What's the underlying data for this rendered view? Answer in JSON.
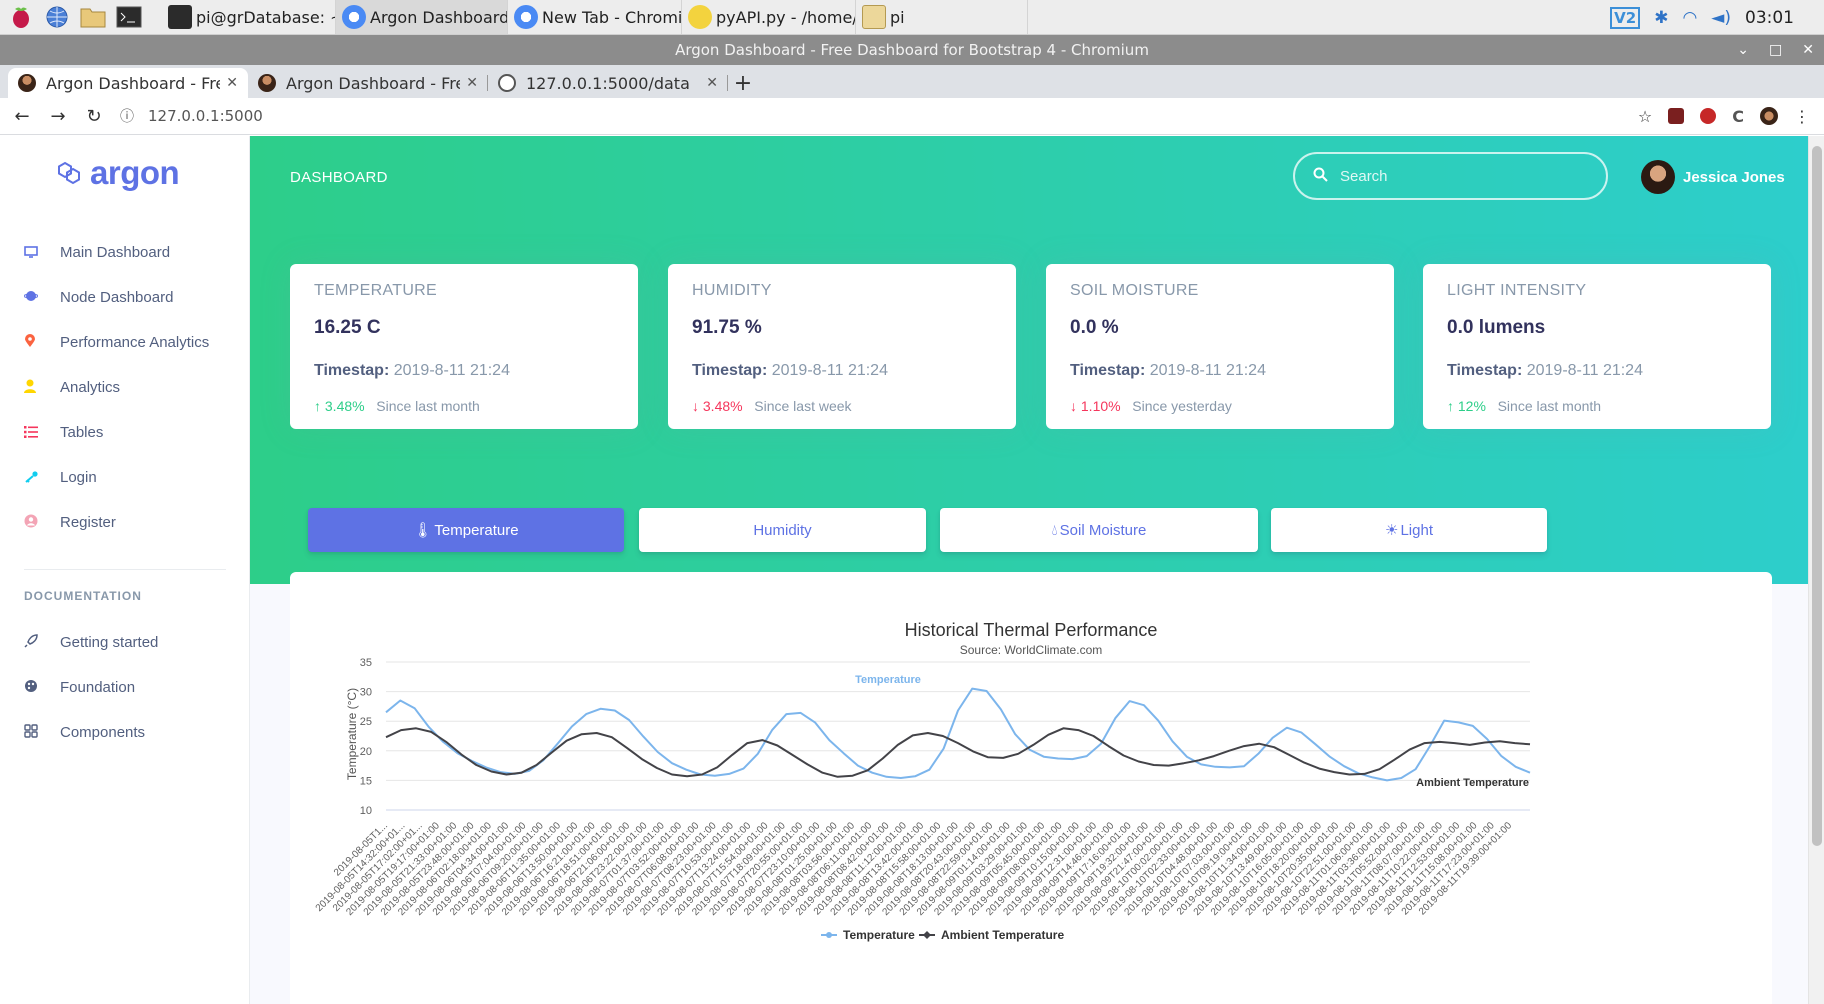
{
  "taskbar": {
    "tasks": [
      {
        "label": "pi@grDatabase: ~",
        "icon": "terminal-icon"
      },
      {
        "label": "Argon Dashboard - Fr...",
        "icon": "chromium-icon"
      },
      {
        "label": "New Tab - Chromium",
        "icon": "chromium-icon"
      },
      {
        "label": "pyAPI.py - /home/pi/...",
        "icon": "python-icon"
      },
      {
        "label": "pi",
        "icon": "folder-icon"
      }
    ],
    "clock": "03:01"
  },
  "window": {
    "title": "Argon Dashboard - Free Dashboard for Bootstrap 4 - Chromium"
  },
  "browser": {
    "tabs": [
      {
        "label": "Argon Dashboard - Free Da"
      },
      {
        "label": "Argon Dashboard - Free Da"
      },
      {
        "label": "127.0.0.1:5000/data"
      }
    ],
    "url": "127.0.0.1:5000"
  },
  "sidebar": {
    "brand": "argon",
    "items": [
      {
        "label": "Main Dashboard",
        "icon": "monitor-icon",
        "color": "#5e72e4"
      },
      {
        "label": "Node Dashboard",
        "icon": "planet-icon",
        "color": "#5e72e4"
      },
      {
        "label": "Performance Analytics",
        "icon": "pin-icon",
        "color": "#fb6340"
      },
      {
        "label": "Analytics",
        "icon": "user-icon",
        "color": "#ffd600"
      },
      {
        "label": "Tables",
        "icon": "list-icon",
        "color": "#f5365c"
      },
      {
        "label": "Login",
        "icon": "key-icon",
        "color": "#11cdef"
      },
      {
        "label": "Register",
        "icon": "circle-user-icon",
        "color": "#f3a4b5"
      }
    ],
    "doc_heading": "DOCUMENTATION",
    "doc_items": [
      {
        "label": "Getting started",
        "icon": "spaceship-icon"
      },
      {
        "label": "Foundation",
        "icon": "palette-icon"
      },
      {
        "label": "Components",
        "icon": "ui-icon"
      }
    ]
  },
  "header": {
    "title": "DASHBOARD",
    "search_placeholder": "Search",
    "user_name": "Jessica Jones"
  },
  "stats": [
    {
      "title": "TEMPERATURE",
      "value": "16.25 C",
      "ts_label": "Timestap:",
      "ts_value": "2019-8-11 21:24",
      "change": "3.48%",
      "direction": "up",
      "since": "Since last month"
    },
    {
      "title": "HUMIDITY",
      "value": "91.75 %",
      "ts_label": "Timestap:",
      "ts_value": "2019-8-11 21:24",
      "change": "3.48%",
      "direction": "down",
      "since": "Since last week"
    },
    {
      "title": "SOIL MOISTURE",
      "value": "0.0 %",
      "ts_label": "Timestap:",
      "ts_value": "2019-8-11 21:24",
      "change": "1.10%",
      "direction": "down",
      "since": "Since yesterday"
    },
    {
      "title": "LIGHT INTENSITY",
      "value": "0.0 lumens",
      "ts_label": "Timestap:",
      "ts_value": "2019-8-11 21:24",
      "change": "12%",
      "direction": "up",
      "since": "Since last month"
    }
  ],
  "chart_tabs": [
    {
      "label": "Temperature",
      "icon": "thermometer-icon",
      "active": true
    },
    {
      "label": "Humidity",
      "icon": "",
      "active": false
    },
    {
      "label": "Soil Moisture",
      "icon": "drop-icon",
      "active": false
    },
    {
      "label": "Light",
      "icon": "sun-icon",
      "active": false
    }
  ],
  "chart_data": {
    "type": "line",
    "title": "Historical Thermal Performance",
    "subtitle": "Source: WorldClimate.com",
    "ylabel": "Temperature (°C)",
    "xlabel": "",
    "ylim": [
      10,
      35
    ],
    "yticks": [
      10,
      15,
      20,
      25,
      30,
      35
    ],
    "x_range": [
      "2019-08-05T14:32",
      "2019-08-11T19:39"
    ],
    "x_ticks": [
      "2019-08-05T1...",
      "2019-08-05T14:32:00+01...",
      "2019-08-05T17:02:00+01...",
      "2019-08-05T19:17:00+01:00",
      "2019-08-05T21:33:00+01:00",
      "2019-08-05T23:48:00+01:00",
      "2019-08-06T02:18:00+01:00",
      "2019-08-06T04:34:00+01:00",
      "2019-08-06T07:04:00+01:00",
      "2019-08-06T09:20:00+01:00",
      "2019-08-06T11:35:00+01:00",
      "2019-08-06T13:50:00+01:00",
      "2019-08-06T16:21:00+01:00",
      "2019-08-06T18:51:00+01:00",
      "2019-08-06T21:06:00+01:00",
      "2019-08-06T23:22:00+01:00",
      "2019-08-07T01:37:00+01:00",
      "2019-08-07T03:52:00+01:00",
      "2019-08-07T06:08:00+01:00",
      "2019-08-07T08:23:00+01:00",
      "2019-08-07T10:53:00+01:00",
      "2019-08-07T13:24:00+01:00",
      "2019-08-07T15:54:00+01:00",
      "2019-08-07T18:09:00+01:00",
      "2019-08-07T20:55:00+01:00",
      "2019-08-07T23:10:00+01:00",
      "2019-08-08T01:25:00+01:00",
      "2019-08-08T03:56:00+01:00",
      "2019-08-08T06:11:00+01:00",
      "2019-08-08T08:42:00+01:00",
      "2019-08-08T11:12:00+01:00",
      "2019-08-08T13:42:00+01:00",
      "2019-08-08T15:58:00+01:00",
      "2019-08-08T18:13:00+01:00",
      "2019-08-08T20:43:00+01:00",
      "2019-08-08T22:59:00+01:00",
      "2019-08-09T01:14:00+01:00",
      "2019-08-09T03:29:00+01:00",
      "2019-08-09T05:45:00+01:00",
      "2019-08-09T08:00:00+01:00",
      "2019-08-09T10:15:00+01:00",
      "2019-08-09T12:31:00+01:00",
      "2019-08-09T14:46:00+01:00",
      "2019-08-09T17:16:00+01:00",
      "2019-08-09T19:32:00+01:00",
      "2019-08-09T21:47:00+01:00",
      "2019-08-10T00:02:00+01:00",
      "2019-08-10T02:33:00+01:00",
      "2019-08-10T04:48:00+01:00",
      "2019-08-10T07:03:00+01:00",
      "2019-08-10T09:19:00+01:00",
      "2019-08-10T11:34:00+01:00",
      "2019-08-10T13:49:00+01:00",
      "2019-08-10T16:05:00+01:00",
      "2019-08-10T18:20:00+01:00",
      "2019-08-10T20:35:00+01:00",
      "2019-08-10T22:51:00+01:00",
      "2019-08-11T01:06:00+01:00",
      "2019-08-11T03:36:00+01:00",
      "2019-08-11T05:52:00+01:00",
      "2019-08-11T08:07:00+01:00",
      "2019-08-11T10:22:00+01:00",
      "2019-08-11T12:53:00+01:00",
      "2019-08-11T15:08:00+01:00",
      "2019-08-11T17:23:00+01:00",
      "2019-08-11T19:39:00+01:00"
    ],
    "series": [
      {
        "name": "Temperature",
        "color": "#7cb5ec",
        "values": [
          26.5,
          28.5,
          27.2,
          24.0,
          21.5,
          19.6,
          18.3,
          17.2,
          16.4,
          16.1,
          16.6,
          18.4,
          21.2,
          24.1,
          26.2,
          27.1,
          26.8,
          25.2,
          22.4,
          19.8,
          17.9,
          16.8,
          16.0,
          15.8,
          16.1,
          17.0,
          19.5,
          23.5,
          26.2,
          26.4,
          24.8,
          21.8,
          19.6,
          17.5,
          16.3,
          15.6,
          15.4,
          15.7,
          16.8,
          20.4,
          26.8,
          30.5,
          30.1,
          27.0,
          22.8,
          20.2,
          19.0,
          18.7,
          18.6,
          19.1,
          21.2,
          25.5,
          28.4,
          27.7,
          25.1,
          21.6,
          19.0,
          17.7,
          17.3,
          17.2,
          17.4,
          19.5,
          22.2,
          23.9,
          23.1,
          21.1,
          19.0,
          17.4,
          16.2,
          15.5,
          15.0,
          15.4,
          16.9,
          20.8,
          25.1,
          24.8,
          24.2,
          22.0,
          19.1,
          17.3,
          16.3
        ]
      },
      {
        "name": "Ambient Temperature",
        "color": "#434348",
        "values": [
          22.3,
          23.5,
          23.8,
          23.2,
          21.5,
          19.4,
          17.6,
          16.5,
          16.0,
          16.3,
          17.6,
          19.7,
          21.7,
          22.8,
          23.0,
          22.3,
          20.5,
          18.6,
          17.1,
          16.0,
          15.7,
          16.0,
          17.2,
          19.3,
          21.3,
          21.8,
          20.9,
          19.3,
          17.7,
          16.3,
          15.6,
          15.8,
          16.7,
          18.7,
          21.0,
          22.6,
          23.0,
          22.5,
          21.3,
          19.9,
          18.9,
          18.8,
          19.5,
          21.0,
          22.7,
          23.8,
          23.5,
          22.5,
          20.8,
          19.2,
          18.2,
          17.6,
          17.5,
          17.9,
          18.4,
          19.1,
          20.0,
          20.8,
          21.2,
          20.6,
          19.3,
          18.0,
          17.0,
          16.4,
          16.0,
          16.1,
          16.9,
          18.5,
          20.2,
          21.3,
          21.5,
          21.3,
          21.0,
          21.4,
          21.6,
          21.3,
          21.1
        ]
      }
    ],
    "series_labels": [
      {
        "text": "Temperature"
      },
      {
        "text": "Ambient Temperature"
      }
    ],
    "legend": "bottom-center",
    "grid": true
  }
}
